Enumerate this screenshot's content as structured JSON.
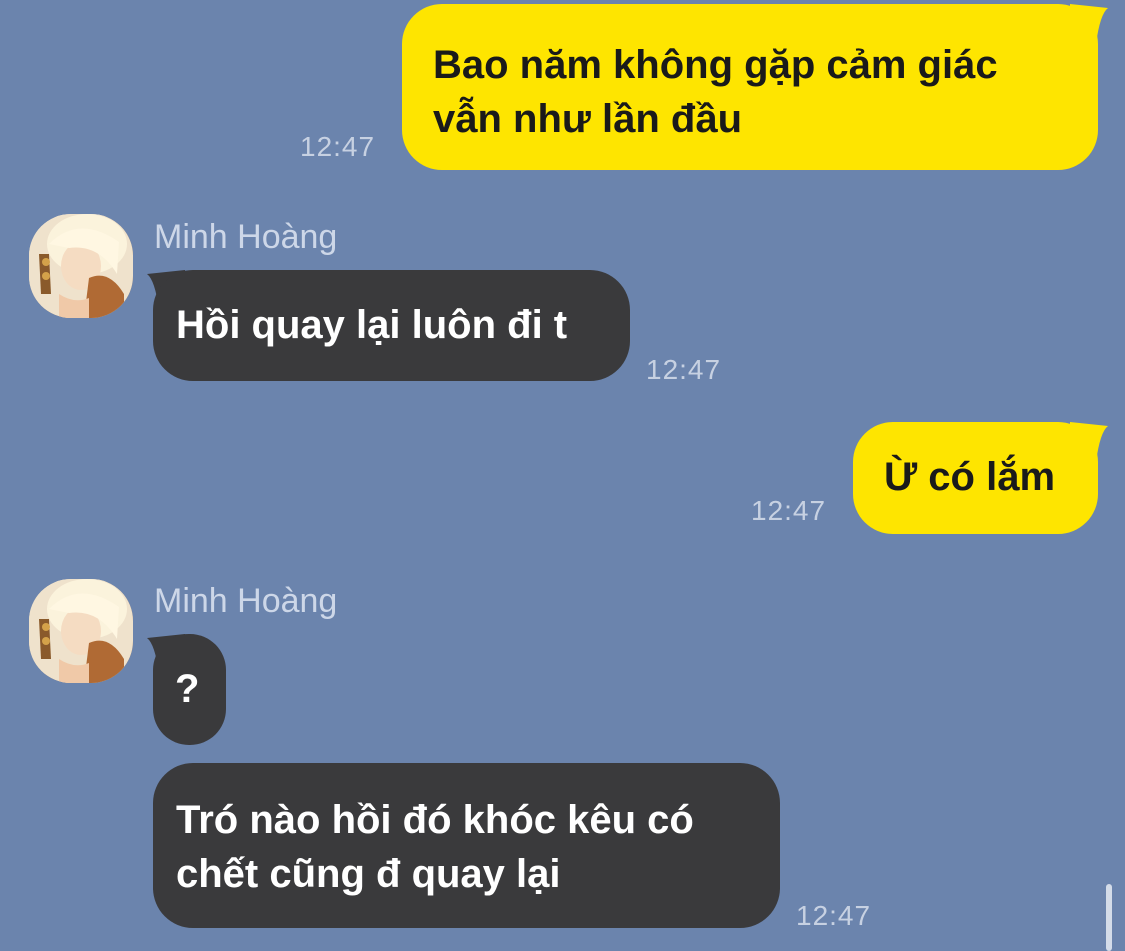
{
  "messages": [
    {
      "id": "m1",
      "direction": "outgoing",
      "lines": [
        "Bao năm không gặp cảm giác",
        "vẫn như lần đầu"
      ],
      "time": "12:47"
    },
    {
      "id": "m2",
      "direction": "incoming",
      "sender": "Minh Hoàng",
      "lines": [
        "Hồi quay lại luôn đi t"
      ],
      "time": "12:47"
    },
    {
      "id": "m3",
      "direction": "outgoing",
      "lines": [
        "Ừ có lắm"
      ],
      "time": "12:47"
    },
    {
      "id": "m4",
      "direction": "incoming",
      "sender": "Minh Hoàng",
      "lines": [
        "?"
      ]
    },
    {
      "id": "m5",
      "direction": "incoming",
      "lines": [
        "Tró nào hồi đó khóc kêu có",
        "chết cũng đ quay lại"
      ],
      "time": "12:47"
    }
  ],
  "colors": {
    "background": "#6b84ad",
    "outgoing_bubble": "#fee500",
    "incoming_bubble": "#3a3a3c"
  },
  "icons": {
    "avatar": "contact-avatar-photo"
  }
}
